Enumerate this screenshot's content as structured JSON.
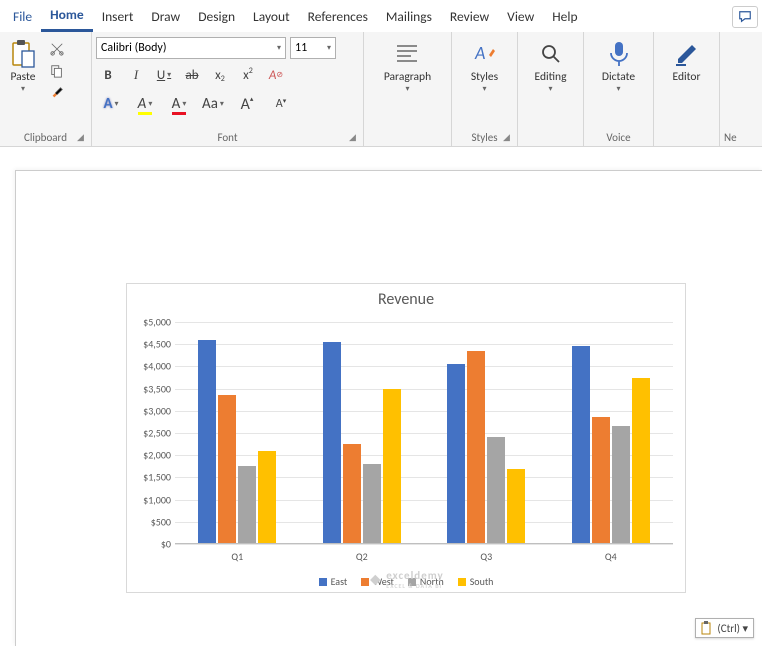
{
  "tabs": {
    "file": "File",
    "home": "Home",
    "insert": "Insert",
    "draw": "Draw",
    "design": "Design",
    "layout": "Layout",
    "references": "References",
    "mailings": "Mailings",
    "review": "Review",
    "view": "View",
    "help": "Help"
  },
  "ribbon": {
    "clipboard": {
      "label": "Clipboard",
      "paste": "Paste"
    },
    "font": {
      "label": "Font",
      "name": "Calibri (Body)",
      "size": "11",
      "bold": "B",
      "italic": "I",
      "underline": "U",
      "strike": "ab",
      "sub": "x",
      "subi": "2",
      "sup": "x",
      "supi": "2",
      "texteffects": "A",
      "highlight": "A",
      "fontcolor": "A",
      "case": "Aa",
      "clear": "A",
      "grow": "A",
      "shrink": "A"
    },
    "paragraph": {
      "label": "Paragraph"
    },
    "styles": {
      "label": "Styles"
    },
    "editing": {
      "label": "Editing"
    },
    "voice": {
      "label": "Voice",
      "dictate": "Dictate"
    },
    "editor": {
      "label": "Editor"
    },
    "next": "Ne"
  },
  "chart_data": {
    "type": "bar",
    "title": "Revenue",
    "categories": [
      "Q1",
      "Q2",
      "Q3",
      "Q4"
    ],
    "series": [
      {
        "name": "East",
        "values": [
          4600,
          4550,
          4050,
          4450
        ],
        "color": "#4472c4"
      },
      {
        "name": "West",
        "values": [
          3350,
          2250,
          4350,
          2850
        ],
        "color": "#ed7d31"
      },
      {
        "name": "North",
        "values": [
          1750,
          1800,
          2400,
          2650
        ],
        "color": "#a5a5a5"
      },
      {
        "name": "South",
        "values": [
          2100,
          3500,
          1700,
          3750
        ],
        "color": "#ffc000"
      }
    ],
    "ylim": [
      0,
      5000
    ],
    "ytick_step": 500,
    "ytick_prefix": "$",
    "xlabel": "",
    "ylabel": ""
  },
  "watermark": {
    "brand": "exceldemy",
    "tag": "EXCEL & DATA BI"
  },
  "paste_opts": {
    "label": "(Ctrl) ▾"
  }
}
